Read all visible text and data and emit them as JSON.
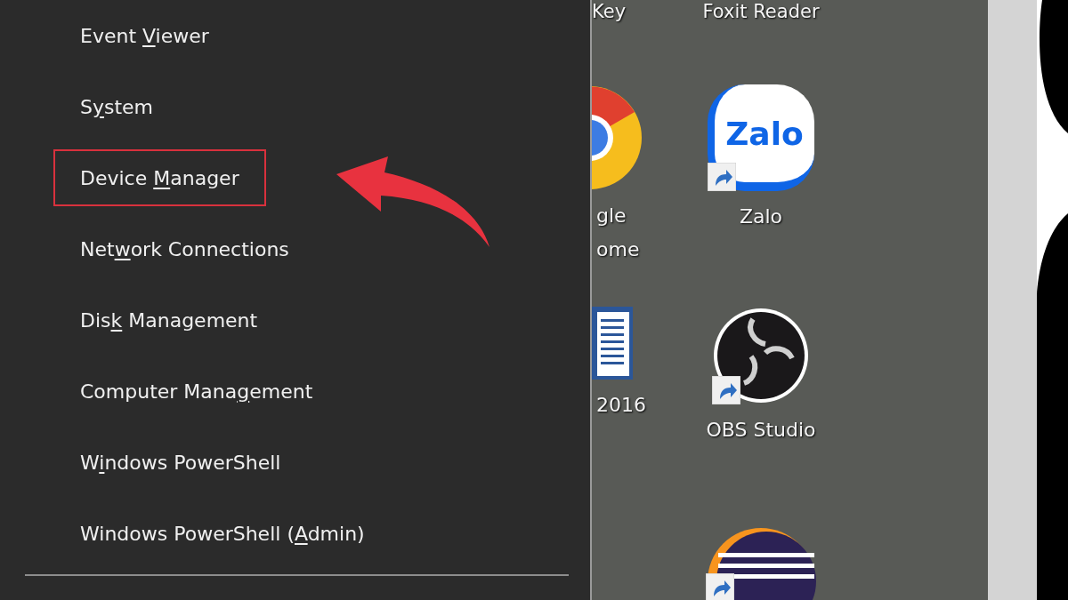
{
  "menu": {
    "items": [
      {
        "label_before": "Event ",
        "access_key": "V",
        "label_after": "iewer",
        "highlighted": false
      },
      {
        "label_before": "S",
        "access_key": "y",
        "label_after": "stem",
        "highlighted": false
      },
      {
        "label_before": "Device ",
        "access_key": "M",
        "label_after": "anager",
        "highlighted": true
      },
      {
        "label_before": "Net",
        "access_key": "w",
        "label_after": "ork Connections",
        "highlighted": false
      },
      {
        "label_before": "Dis",
        "access_key": "k",
        "label_after": " Management",
        "highlighted": false
      },
      {
        "label_before": "Computer Mana",
        "access_key": "g",
        "label_after": "ement",
        "highlighted": false
      },
      {
        "label_before": "W",
        "access_key": "i",
        "label_after": "ndows PowerShell",
        "highlighted": false
      },
      {
        "label_before": "Windows PowerShell (",
        "access_key": "A",
        "label_after": "dmin)",
        "highlighted": false
      }
    ]
  },
  "desktop": {
    "top_labels": [
      "Key",
      "Foxit Reader"
    ],
    "icons": [
      {
        "kind": "chrome",
        "label_lines": [
          "gle",
          "ome"
        ],
        "shortcut": false
      },
      {
        "kind": "zalo",
        "logo_text": "Zalo",
        "label_lines": [
          "Zalo"
        ],
        "shortcut": true
      },
      {
        "kind": "word",
        "label_lines": [
          "2016"
        ],
        "shortcut": false
      },
      {
        "kind": "obs",
        "label_lines": [
          "OBS Studio"
        ],
        "shortcut": true
      },
      {
        "kind": "eclipse",
        "shortcut": true
      }
    ]
  }
}
